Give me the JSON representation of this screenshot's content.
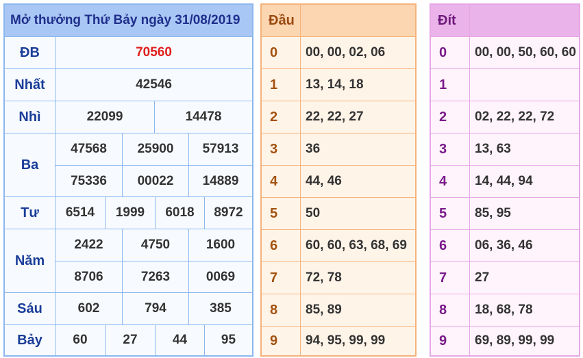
{
  "title": "Mở thưởng Thứ Bảy ngày 31/08/2019",
  "colors": {
    "special_prize": "#e11d1d",
    "label": "#1a3d98"
  },
  "prizes": [
    {
      "label": "ĐB",
      "values": [
        "70560"
      ]
    },
    {
      "label": "Nhất",
      "values": [
        "42546"
      ]
    },
    {
      "label": "Nhì",
      "values": [
        "22099",
        "14478"
      ]
    },
    {
      "label": "Ba",
      "values": [
        "47568",
        "25900",
        "57913",
        "75336",
        "00022",
        "14889"
      ]
    },
    {
      "label": "Tư",
      "values": [
        "6514",
        "1999",
        "6018",
        "8972"
      ]
    },
    {
      "label": "Năm",
      "values": [
        "2422",
        "4750",
        "1600",
        "8706",
        "7263",
        "0069"
      ]
    },
    {
      "label": "Sáu",
      "values": [
        "602",
        "794",
        "385"
      ]
    },
    {
      "label": "Bảy",
      "values": [
        "60",
        "27",
        "44",
        "95"
      ]
    }
  ],
  "dau": {
    "header": "Đầu",
    "rows": [
      {
        "k": "0",
        "v": "00, 00, 02, 06"
      },
      {
        "k": "1",
        "v": "13, 14, 18"
      },
      {
        "k": "2",
        "v": "22, 22, 27"
      },
      {
        "k": "3",
        "v": "36"
      },
      {
        "k": "4",
        "v": "44, 46"
      },
      {
        "k": "5",
        "v": "50"
      },
      {
        "k": "6",
        "v": "60, 60, 63, 68, 69"
      },
      {
        "k": "7",
        "v": "72, 78"
      },
      {
        "k": "8",
        "v": "85, 89"
      },
      {
        "k": "9",
        "v": "94, 95, 99, 99"
      }
    ]
  },
  "dit": {
    "header": "Đít",
    "rows": [
      {
        "k": "0",
        "v": "00, 00, 50, 60, 60"
      },
      {
        "k": "1",
        "v": ""
      },
      {
        "k": "2",
        "v": "02, 22, 22, 72"
      },
      {
        "k": "3",
        "v": "13, 63"
      },
      {
        "k": "4",
        "v": "14, 44, 94"
      },
      {
        "k": "5",
        "v": "85, 95"
      },
      {
        "k": "6",
        "v": "06, 36, 46"
      },
      {
        "k": "7",
        "v": "27"
      },
      {
        "k": "8",
        "v": "18, 68, 78"
      },
      {
        "k": "9",
        "v": "69, 89, 99, 99"
      }
    ]
  }
}
